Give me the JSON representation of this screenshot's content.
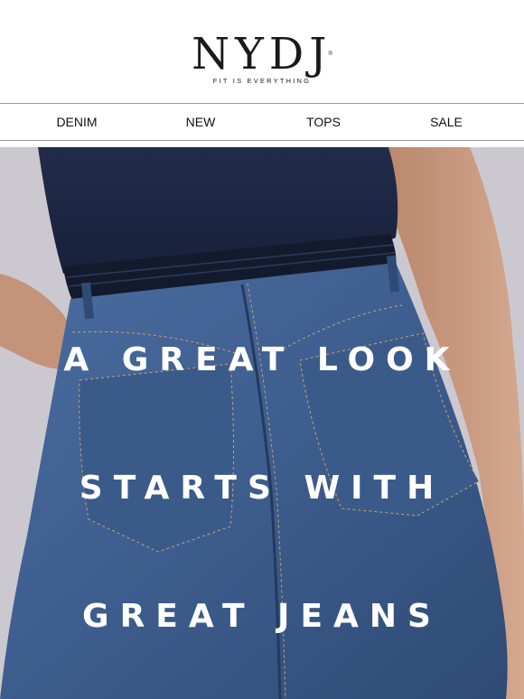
{
  "header": {
    "logo_text": "NYDJ",
    "logo_registered": "®",
    "tagline": "FIT IS EVERYTHING"
  },
  "nav": {
    "items": [
      {
        "label": "DENIM"
      },
      {
        "label": "NEW"
      },
      {
        "label": "TOPS"
      },
      {
        "label": "SALE"
      }
    ]
  },
  "hero": {
    "lines": [
      "A GREAT LOOK",
      "STARTS WITH",
      "GREAT JEANS"
    ],
    "colors": {
      "background": "#c9c7cd",
      "top": "#1c2540",
      "waistband": "#141a2b",
      "denim": "#3f5f8f",
      "skin": "#c99a80"
    }
  }
}
